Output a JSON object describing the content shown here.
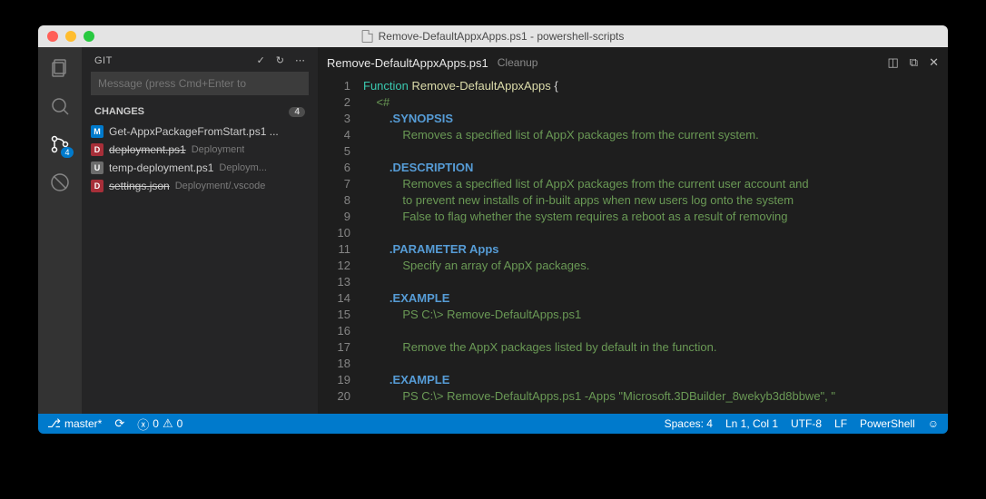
{
  "window": {
    "title": "Remove-DefaultAppxApps.ps1 - powershell-scripts"
  },
  "sidebar": {
    "title": "GIT",
    "message_placeholder": "Message (press Cmd+Enter to",
    "changes_label": "CHANGES",
    "changes_count": "4",
    "scm_badge": "4",
    "items": [
      {
        "status": "M",
        "name": "Get-AppxPackageFromStart.ps1 ...",
        "path": "",
        "struck": false
      },
      {
        "status": "D",
        "name": "deployment.ps1",
        "path": "Deployment",
        "struck": true
      },
      {
        "status": "U",
        "name": "temp-deployment.ps1",
        "path": "Deploym...",
        "struck": false
      },
      {
        "status": "D",
        "name": "settings.json",
        "path": "Deployment/.vscode",
        "struck": true
      }
    ]
  },
  "editor": {
    "tab_filename": "Remove-DefaultAppxApps.ps1",
    "tab_subtitle": "Cleanup",
    "lines": [
      {
        "n": "1",
        "html": "<span class='kw'>Function</span> <span class='fn2'>Remove-DefaultAppxApps</span> <span class='pn'>{</span>"
      },
      {
        "n": "2",
        "html": "    <span class='cm'>&lt;#</span>"
      },
      {
        "n": "3",
        "html": "        <span class='tag'>.SYNOPSIS</span>"
      },
      {
        "n": "4",
        "html": "            <span class='cm'>Removes a specified list of AppX packages from the current system.</span>"
      },
      {
        "n": "5",
        "html": ""
      },
      {
        "n": "6",
        "html": "        <span class='tag'>.DESCRIPTION</span>"
      },
      {
        "n": "7",
        "html": "            <span class='cm'>Removes a specified list of AppX packages from the current user account and</span>"
      },
      {
        "n": "8",
        "html": "            <span class='cm'>to prevent new installs of in-built apps when new users log onto the system</span>"
      },
      {
        "n": "9",
        "html": "            <span class='cm'>False to flag whether the system requires a reboot as a result of removing </span>"
      },
      {
        "n": "10",
        "html": ""
      },
      {
        "n": "11",
        "html": "        <span class='tag'>.PARAMETER Apps</span>"
      },
      {
        "n": "12",
        "html": "            <span class='cm'>Specify an array of AppX packages.</span>"
      },
      {
        "n": "13",
        "html": ""
      },
      {
        "n": "14",
        "html": "        <span class='tag'>.EXAMPLE</span>"
      },
      {
        "n": "15",
        "html": "            <span class='cm'>PS C:\\&gt; Remove-DefaultApps.ps1</span>"
      },
      {
        "n": "16",
        "html": ""
      },
      {
        "n": "17",
        "html": "            <span class='cm'>Remove the AppX packages listed by default in the function.</span>"
      },
      {
        "n": "18",
        "html": ""
      },
      {
        "n": "19",
        "html": "        <span class='tag'>.EXAMPLE</span>"
      },
      {
        "n": "20",
        "html": "            <span class='cm'>PS C:\\&gt; Remove-DefaultApps.ps1 -Apps \"Microsoft.3DBuilder_8wekyb3d8bbwe\", \"</span>"
      }
    ]
  },
  "statusbar": {
    "branch": "master*",
    "errors": "0",
    "warnings": "0",
    "spaces": "Spaces: 4",
    "position": "Ln 1, Col 1",
    "encoding": "UTF-8",
    "eol": "LF",
    "language": "PowerShell"
  }
}
